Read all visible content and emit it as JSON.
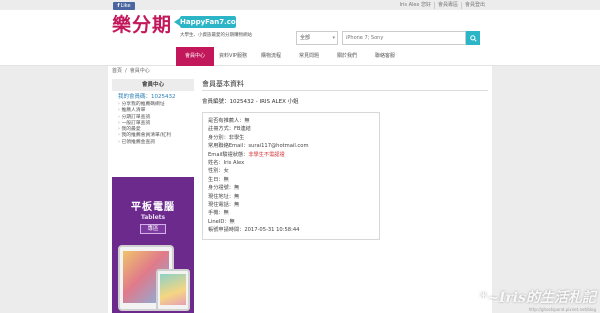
{
  "topbar": {
    "fb_like": "Like",
    "links": [
      "Iris Alex 您好",
      "會員專區",
      "會員登出"
    ]
  },
  "header": {
    "logo": "樂分期",
    "badge": "HappyFan7.com",
    "tagline": "大學生、小資族最愛的分期購物網站"
  },
  "search": {
    "category": "全部",
    "placeholder": "iPhone 7; Sony"
  },
  "nav": {
    "items": [
      "會員中心",
      "資料VIP服務",
      "購物流程",
      "常見問題",
      "關於我們",
      "聯絡客服"
    ],
    "active_index": 0
  },
  "breadcrumb": {
    "home": "首頁",
    "current": "會員中心"
  },
  "sidebar": {
    "heading": "會員中心",
    "member_id": "我的會員碼：1025432",
    "menu": [
      "分享我的推薦碼網址",
      "推薦人清單",
      "分期訂單查詢",
      "一般訂單查詢",
      "我的最愛",
      "我的推薦會員清單/紅利",
      "已領推薦金查詢"
    ]
  },
  "ad": {
    "title": "平板電腦",
    "subtitle": "Tablets",
    "button": "專區"
  },
  "profile": {
    "heading": "會員基本資料",
    "member_no": "會員編號：1025432 - IRIS ALEX 小姐",
    "rows": [
      {
        "label": "是否有推薦人：",
        "value": "無",
        "warn": ""
      },
      {
        "label": "註冊方式：",
        "value": "FB連結",
        "warn": ""
      },
      {
        "label": "身分別：",
        "value": "非學生",
        "warn": ""
      },
      {
        "label": "常用聯絡Email：",
        "value": "surai117@hotmail.com",
        "warn": ""
      },
      {
        "label": "Email驗證狀態：",
        "value": "",
        "warn": "非學生不需認證"
      },
      {
        "label": "姓名：",
        "value": "Iris Alex",
        "warn": ""
      },
      {
        "label": "性別：",
        "value": "女",
        "warn": ""
      },
      {
        "label": "生日：",
        "value": "無",
        "warn": ""
      },
      {
        "label": "身分證號：",
        "value": "無",
        "warn": ""
      },
      {
        "label": "現住地址：",
        "value": "無",
        "warn": ""
      },
      {
        "label": "現住電話：",
        "value": "無",
        "warn": ""
      },
      {
        "label": "手機：",
        "value": "無",
        "warn": ""
      },
      {
        "label": "LineID：",
        "value": "無",
        "warn": ""
      },
      {
        "label": "帳號申請時間：",
        "value": "2017-05-31 10:58:44",
        "warn": ""
      }
    ]
  },
  "watermark": {
    "main": "*~Iris的生活札記",
    "url": "http://ghostspond.pixnet.net/blog"
  },
  "colors": {
    "brand": "#c2185b",
    "accent": "#2bb5c7",
    "ad_bg": "#6b2a8c",
    "warn": "#d32f2f"
  }
}
